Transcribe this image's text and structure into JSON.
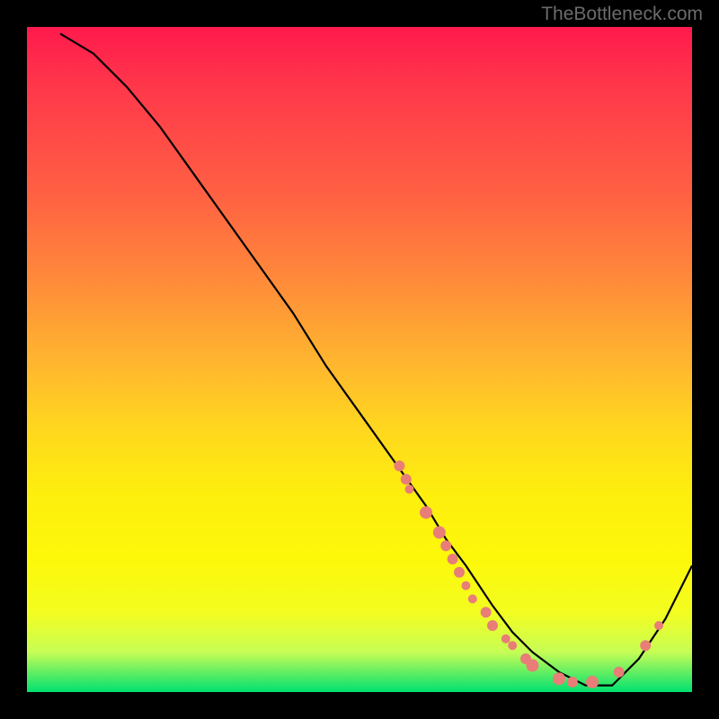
{
  "watermark": "TheBottleneck.com",
  "chart_data": {
    "type": "line",
    "title": "",
    "xlabel": "",
    "ylabel": "",
    "xlim": [
      0,
      100
    ],
    "ylim": [
      0,
      100
    ],
    "series": [
      {
        "name": "bottleneck-curve",
        "x": [
          5,
          10,
          15,
          20,
          25,
          30,
          35,
          40,
          45,
          50,
          55,
          60,
          63,
          66,
          70,
          73,
          76,
          80,
          84,
          88,
          92,
          96,
          100
        ],
        "y": [
          99,
          96,
          91,
          85,
          78,
          71,
          64,
          57,
          49,
          42,
          35,
          28,
          23,
          19,
          13,
          9,
          6,
          3,
          1,
          1,
          5,
          11,
          19
        ]
      }
    ],
    "scatter": {
      "name": "highlight-points",
      "color": "#e87e77",
      "points": [
        {
          "x": 56,
          "y": 34,
          "r": 6
        },
        {
          "x": 57,
          "y": 32,
          "r": 6
        },
        {
          "x": 57.5,
          "y": 30.5,
          "r": 5
        },
        {
          "x": 60,
          "y": 27,
          "r": 7
        },
        {
          "x": 62,
          "y": 24,
          "r": 7
        },
        {
          "x": 63,
          "y": 22,
          "r": 6
        },
        {
          "x": 64,
          "y": 20,
          "r": 6
        },
        {
          "x": 65,
          "y": 18,
          "r": 6
        },
        {
          "x": 66,
          "y": 16,
          "r": 5
        },
        {
          "x": 67,
          "y": 14,
          "r": 5
        },
        {
          "x": 69,
          "y": 12,
          "r": 6
        },
        {
          "x": 70,
          "y": 10,
          "r": 6
        },
        {
          "x": 72,
          "y": 8,
          "r": 5
        },
        {
          "x": 73,
          "y": 7,
          "r": 5
        },
        {
          "x": 75,
          "y": 5,
          "r": 6
        },
        {
          "x": 76,
          "y": 4,
          "r": 7
        },
        {
          "x": 80,
          "y": 2,
          "r": 7
        },
        {
          "x": 82,
          "y": 1.5,
          "r": 6
        },
        {
          "x": 85,
          "y": 1.5,
          "r": 7
        },
        {
          "x": 89,
          "y": 3,
          "r": 6
        },
        {
          "x": 93,
          "y": 7,
          "r": 6
        },
        {
          "x": 95,
          "y": 10,
          "r": 5
        }
      ]
    },
    "gradient_stops": [
      {
        "pos": 0,
        "color": "#ff1a4d"
      },
      {
        "pos": 25,
        "color": "#ff6043"
      },
      {
        "pos": 50,
        "color": "#ffb42f"
      },
      {
        "pos": 70,
        "color": "#fdee0e"
      },
      {
        "pos": 94,
        "color": "#c7fd55"
      },
      {
        "pos": 100,
        "color": "#00e070"
      }
    ]
  }
}
